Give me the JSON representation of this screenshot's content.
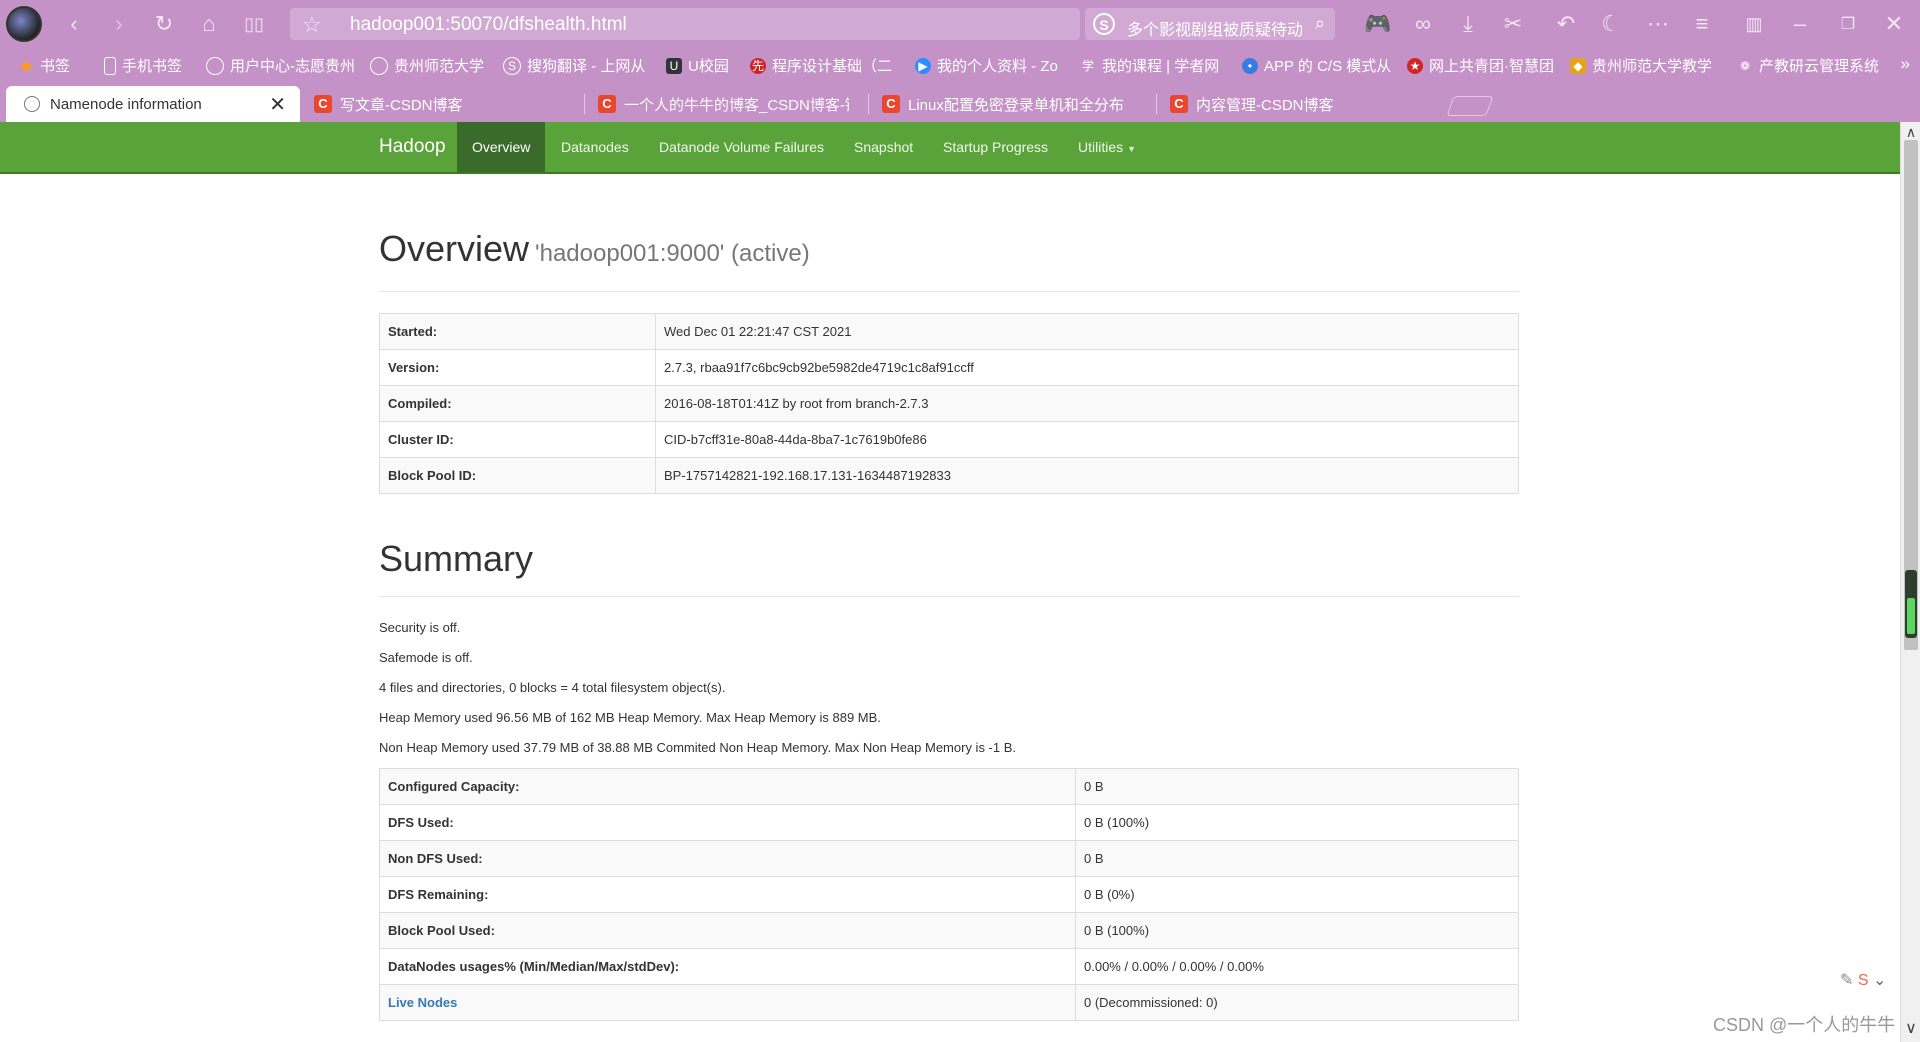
{
  "browser": {
    "url": "hadoop001:50070/dfshealth.html",
    "search_text": "多个影视剧组被质疑待动物",
    "bookmarks": [
      {
        "label": "书签"
      },
      {
        "label": "手机书签"
      },
      {
        "label": "用户中心-志愿贵州"
      },
      {
        "label": "贵州师范大学"
      },
      {
        "label": "搜狗翻译 - 上网从"
      },
      {
        "label": "U校园"
      },
      {
        "label": "程序设计基础（二"
      },
      {
        "label": "我的个人资料 - Zo"
      },
      {
        "label": "我的课程 | 学者网"
      },
      {
        "label": "APP 的 C/S 模式从"
      },
      {
        "label": "网上共青团·智慧团"
      },
      {
        "label": "贵州师范大学教学"
      },
      {
        "label": "产教研云管理系统"
      }
    ],
    "tabs": [
      {
        "label": "Namenode information",
        "active": true
      },
      {
        "label": "写文章-CSDN博客"
      },
      {
        "label": "一个人的牛牛的博客_CSDN博客-镜"
      },
      {
        "label": "Linux配置免密登录单机和全分布"
      },
      {
        "label": "内容管理-CSDN博客"
      }
    ]
  },
  "navbar": {
    "brand": "Hadoop",
    "items": [
      {
        "label": "Overview",
        "active": true
      },
      {
        "label": "Datanodes"
      },
      {
        "label": "Datanode Volume Failures"
      },
      {
        "label": "Snapshot"
      },
      {
        "label": "Startup Progress"
      },
      {
        "label": "Utilities"
      }
    ]
  },
  "overview": {
    "title": "Overview",
    "subtitle": "'hadoop001:9000' (active)",
    "rows": [
      {
        "key": "Started:",
        "value": "Wed Dec 01 22:21:47 CST 2021"
      },
      {
        "key": "Version:",
        "value": "2.7.3, rbaa91f7c6bc9cb92be5982de4719c1c8af91ccff"
      },
      {
        "key": "Compiled:",
        "value": "2016-08-18T01:41Z by root from branch-2.7.3"
      },
      {
        "key": "Cluster ID:",
        "value": "CID-b7cff31e-80a8-44da-8ba7-1c7619b0fe86"
      },
      {
        "key": "Block Pool ID:",
        "value": "BP-1757142821-192.168.17.131-1634487192833"
      }
    ]
  },
  "summary": {
    "title": "Summary",
    "lines": [
      "Security is off.",
      "Safemode is off.",
      "4 files and directories, 0 blocks = 4 total filesystem object(s).",
      "Heap Memory used 96.56 MB of 162 MB Heap Memory. Max Heap Memory is 889 MB.",
      "Non Heap Memory used 37.79 MB of 38.88 MB Commited Non Heap Memory. Max Non Heap Memory is -1 B."
    ],
    "rows": [
      {
        "key": "Configured Capacity:",
        "value": "0 B"
      },
      {
        "key": "DFS Used:",
        "value": "0 B (100%)"
      },
      {
        "key": "Non DFS Used:",
        "value": "0 B"
      },
      {
        "key": "DFS Remaining:",
        "value": "0 B (0%)"
      },
      {
        "key": "Block Pool Used:",
        "value": "0 B (100%)"
      },
      {
        "key": "DataNodes usages% (Min/Median/Max/stdDev):",
        "value": "0.00% / 0.00% / 0.00% / 0.00%"
      },
      {
        "key": "Live Nodes",
        "value": "0 (Decommissioned: 0)",
        "link": true
      }
    ]
  },
  "watermark": "CSDN @一个人的牛牛"
}
